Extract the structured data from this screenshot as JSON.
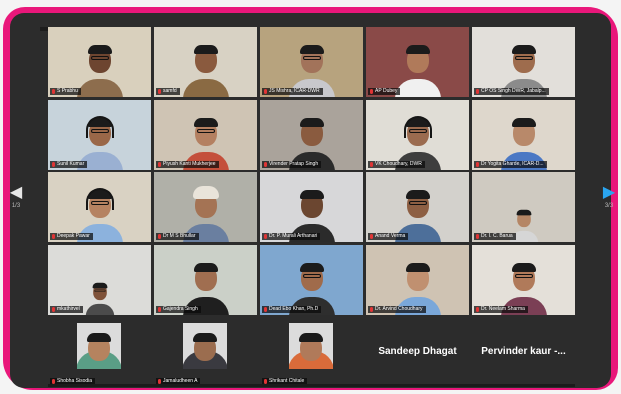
{
  "navigation": {
    "prev_arrow": "◀",
    "next_arrow": "▶",
    "prev_page": "1/3",
    "next_page": "3/3"
  },
  "participants": [
    {
      "name": "S Prabhu",
      "active": true,
      "bg": "#d9d0bd",
      "shirt": "#8d6d4d",
      "skin": "#6d4530",
      "kind": "specs"
    },
    {
      "name": "samfd",
      "bg": "#d8d2c4",
      "shirt": "#8a6a43",
      "skin": "#8a5a3e",
      "kind": "plain"
    },
    {
      "name": "JS Mishra, ICAR-DWR",
      "bg": "#b7a37e",
      "shirt": "#c8c8cc",
      "skin": "#a2735a",
      "kind": "specs"
    },
    {
      "name": "AP Dubey",
      "bg": "#8a4a48",
      "shirt": "#f0f0f0",
      "skin": "#b07a5a",
      "kind": "plain"
    },
    {
      "name": "CP OS Singh DWR, Jabalp...",
      "bg": "#e2dfda",
      "shirt": "#8b8b8b",
      "skin": "#9e6c4d",
      "kind": "specs"
    },
    {
      "name": "Sunil Kumar",
      "bg": "#c7d3db",
      "shirt": "#9ab0d2",
      "skin": "#9a6748",
      "kind": "headset"
    },
    {
      "name": "Piyush Kanti Mukherjee",
      "bg": "#cfc4b4",
      "shirt": "#c44f3b",
      "skin": "#b48061",
      "kind": "specs"
    },
    {
      "name": "Virender Pratap Singh",
      "bg": "#aaa39b",
      "shirt": "#2b2b2b",
      "skin": "#8a5b3f",
      "kind": "plain"
    },
    {
      "name": "VK Choudhary, DWR",
      "bg": "#e0ddd6",
      "shirt": "#3e3e3e",
      "skin": "#9b6b4f",
      "kind": "headset"
    },
    {
      "name": "Dr Yogita Gharde, ICAR-D...",
      "bg": "#ded7cc",
      "shirt": "#4b78c4",
      "skin": "#b8896a",
      "kind": "plain"
    },
    {
      "name": "Deepak Pawar",
      "bg": "#d9d2c3",
      "shirt": "#8cb2dd",
      "skin": "#b58261",
      "kind": "headset"
    },
    {
      "name": "Dr M S Bhullar",
      "bg": "#b0b0a8",
      "shirt": "#6a7fa0",
      "skin": "#a47354",
      "kind": "turban"
    },
    {
      "name": "Dr. P. Murali Arthanari",
      "bg": "#d7d7d9",
      "shirt": "#2b2b2b",
      "skin": "#6b4630",
      "kind": "plain"
    },
    {
      "name": "Anand Verma",
      "bg": "#d3d1cc",
      "shirt": "#4d6f9a",
      "skin": "#8d5f43",
      "kind": "specs"
    },
    {
      "name": "Dr. I. C. Barua",
      "bg": "#cfcac1",
      "shirt": "#d6d6d6",
      "skin": "#b58665",
      "kind": "plain",
      "small": true
    },
    {
      "name": "mkathirvel",
      "bg": "#dcdcd9",
      "shirt": "#4b4b4b",
      "skin": "#7f5239",
      "kind": "specs",
      "small": true
    },
    {
      "name": "Gajendra Singh",
      "bg": "#cbd0c8",
      "shirt": "#1f1f1f",
      "skin": "#a06e50",
      "kind": "plain"
    },
    {
      "name": "Dead Ebo Khan, Ph.D",
      "bg": "#7fa7cf",
      "shirt": "#2e2e2e",
      "skin": "#a06b4b",
      "kind": "specs"
    },
    {
      "name": "Dr. Arvind Choudhary",
      "bg": "#cfc3b3",
      "shirt": "#7aa7d9",
      "skin": "#c09070",
      "kind": "plain"
    },
    {
      "name": "Dr. Neelam Sharma",
      "bg": "#e4e0d9",
      "shirt": "#7b3f55",
      "skin": "#b07a5a",
      "kind": "specs"
    },
    {
      "name": "Shobha Sisodia",
      "bg": "#2c2c2c",
      "shirt": "#5a9e86",
      "skin": "#b5835f",
      "kind": "plain",
      "photo": true
    },
    {
      "name": "Jamaludheen A",
      "bg": "#2c2c2c",
      "shirt": "#3a3a40",
      "skin": "#9b6d4f",
      "kind": "plain",
      "photo": true
    },
    {
      "name": "Shrikant Chitale",
      "bg": "#2c2c2c",
      "shirt": "#d96b3a",
      "skin": "#b07a5a",
      "kind": "plain",
      "photo": true
    },
    {
      "name": "Sandeep Dhagat",
      "bg": "#2c2c2c",
      "big": true
    },
    {
      "name": "Pervinder kaur -...",
      "bg": "#2c2c2c",
      "big": true
    }
  ]
}
